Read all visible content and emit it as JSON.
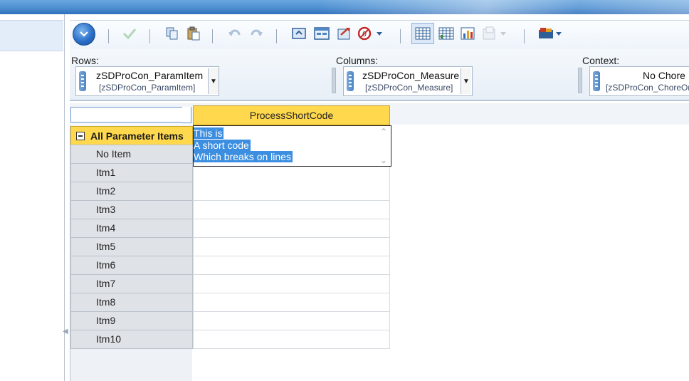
{
  "toolbar": {
    "buttons": [
      {
        "icon": "circle-menu-icon"
      },
      {
        "icon": "checkmark-icon"
      },
      {
        "icon": "copy-icon"
      },
      {
        "icon": "paste-icon"
      },
      {
        "icon": "undo-icon"
      },
      {
        "icon": "redo-icon"
      },
      {
        "icon": "export-icon"
      },
      {
        "icon": "view-icon"
      },
      {
        "icon": "swap-icon"
      },
      {
        "icon": "zero-suppress-icon"
      },
      {
        "icon": "grid-view-icon"
      },
      {
        "icon": "grid-chart-view-icon"
      },
      {
        "icon": "chart-view-icon"
      },
      {
        "icon": "chart-options-icon"
      },
      {
        "icon": "sandbox-icon"
      }
    ]
  },
  "dimensions": {
    "rows": {
      "label": "Rows:",
      "name": "zSDProCon_ParamItem",
      "sub": "[zSDProCon_ParamItem]"
    },
    "columns": {
      "label": "Columns:",
      "name": "zSDProCon_Measure",
      "sub": "[zSDProCon_Measure]"
    },
    "context": {
      "label": "Context:",
      "name": "No Chore",
      "sub": "[zSDProCon_ChoreOr"
    }
  },
  "grid": {
    "column_header": "ProcessShortCode",
    "all_items_label": "All Parameter Items",
    "rows": [
      "No Item",
      "Itm1",
      "Itm2",
      "Itm3",
      "Itm4",
      "Itm5",
      "Itm6",
      "Itm7",
      "Itm8",
      "Itm9",
      "Itm10"
    ],
    "edit_lines": [
      "This is",
      "A short code",
      "Which breaks on lines"
    ]
  },
  "colors": {
    "header_yellow": "#ffd84d",
    "selection_blue": "#3b8ee0",
    "title_bar_blue": "#4f8fd1"
  }
}
